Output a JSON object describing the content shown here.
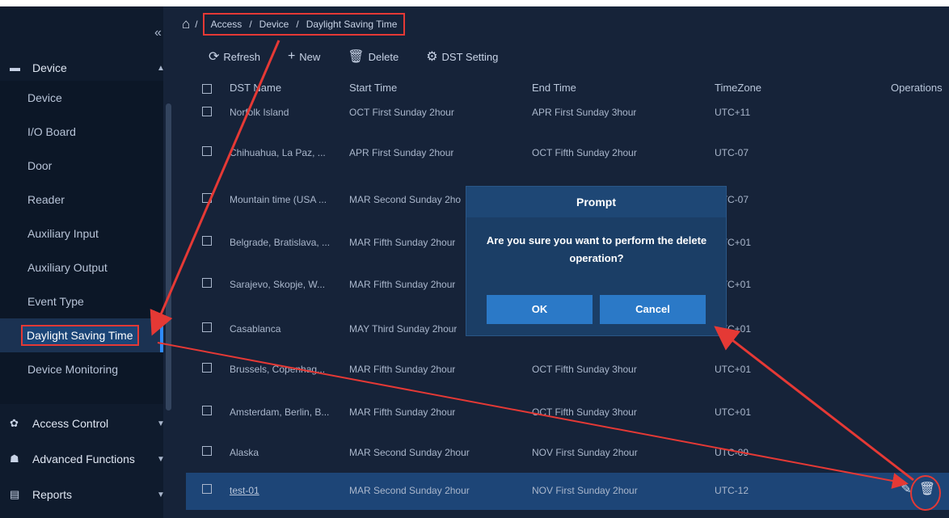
{
  "sidebar": {
    "collapse_icon": "«",
    "device_label": "Device",
    "items": [
      {
        "label": "Device"
      },
      {
        "label": "I/O Board"
      },
      {
        "label": "Door"
      },
      {
        "label": "Reader"
      },
      {
        "label": "Auxiliary Input"
      },
      {
        "label": "Auxiliary Output"
      },
      {
        "label": "Event Type"
      },
      {
        "label": "Daylight Saving Time"
      },
      {
        "label": "Device Monitoring"
      }
    ],
    "access_control": "Access Control",
    "advanced_functions": "Advanced Functions",
    "reports": "Reports"
  },
  "breadcrumb": {
    "items": [
      "Access",
      "/",
      "Device",
      "/",
      "Daylight Saving Time"
    ],
    "sep": "/"
  },
  "toolbar": {
    "refresh": "Refresh",
    "new": "New",
    "delete": "Delete",
    "dst_setting": "DST Setting"
  },
  "table": {
    "headers": {
      "name": "DST Name",
      "start": "Start Time",
      "end": "End Time",
      "tz": "TimeZone",
      "ops": "Operations"
    },
    "rows": [
      {
        "name": "Norfolk Island",
        "start": "OCT First Sunday 2hour",
        "end": "APR First Sunday 3hour",
        "tz": "UTC+11"
      },
      {
        "name": "Chihuahua, La Paz, ...",
        "start": "APR First Sunday 2hour",
        "end": "OCT Fifth Sunday 2hour",
        "tz": "UTC-07"
      },
      {
        "name": "Mountain time (USA ...",
        "start": "MAR Second Sunday 2ho",
        "end": "",
        "tz": "UTC-07"
      },
      {
        "name": "Belgrade, Bratislava, ...",
        "start": "MAR Fifth Sunday 2hour",
        "end": "",
        "tz": "UTC+01"
      },
      {
        "name": "Sarajevo, Skopje, W...",
        "start": "MAR Fifth Sunday 2hour",
        "end": "",
        "tz": "UTC+01"
      },
      {
        "name": "Casablanca",
        "start": "MAY Third Sunday 2hour",
        "end": "",
        "tz": "UTC+01"
      },
      {
        "name": "Brussels, Copenhag...",
        "start": "MAR Fifth Sunday 2hour",
        "end": "OCT Fifth Sunday 3hour",
        "tz": "UTC+01"
      },
      {
        "name": "Amsterdam, Berlin, B...",
        "start": "MAR Fifth Sunday 2hour",
        "end": "OCT Fifth Sunday 3hour",
        "tz": "UTC+01"
      },
      {
        "name": "Alaska",
        "start": "MAR Second Sunday 2hour",
        "end": "NOV First Sunday 2hour",
        "tz": "UTC-09"
      },
      {
        "name": "test-01",
        "start": "MAR Second Sunday 2hour",
        "end": "NOV First Sunday 2hour",
        "tz": "UTC-12"
      }
    ]
  },
  "modal": {
    "title": "Prompt",
    "message": "Are you sure you want to perform the delete operation?",
    "ok": "OK",
    "cancel": "Cancel"
  },
  "colors": {
    "accent": "#2b79c7",
    "annotation": "#e53935",
    "background": "#162339"
  }
}
